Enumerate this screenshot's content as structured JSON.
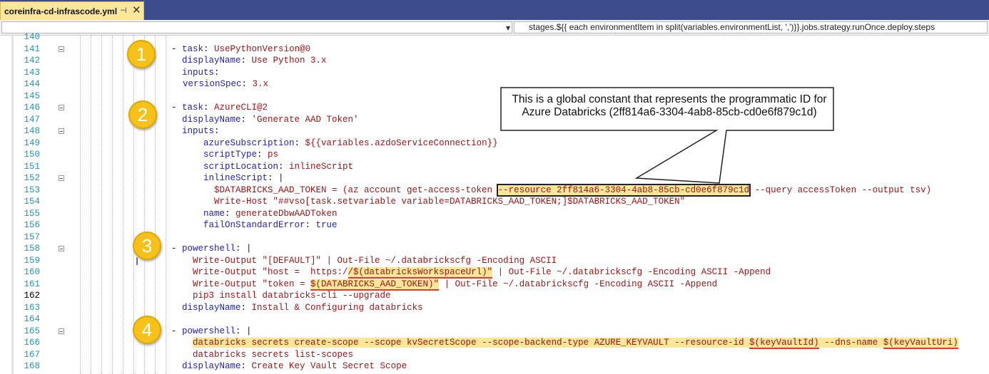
{
  "tab": {
    "title": "coreinfra-cd-infrascode.yml",
    "pin_icon": "pin-icon",
    "close_icon": "close-icon",
    "pin_glyph": "⊣",
    "close_glyph": "✕"
  },
  "navbar": {
    "left_value": "",
    "dropdown_icon": "chevron-down-icon",
    "dropdown_glyph": "▼",
    "right_value": "stages.${{ each environmentItem in split(variables.environmentList, ',')}}.jobs.strategy.runOnce.deploy.steps"
  },
  "editor": {
    "current_line": "162",
    "lines": [
      {
        "num": "140",
        "segs": []
      },
      {
        "num": "141",
        "segs": [
          [
            "- ",
            "t"
          ],
          [
            "task",
            "k"
          ],
          [
            ": ",
            "t"
          ],
          [
            "UsePythonVersion@0",
            "v"
          ]
        ]
      },
      {
        "num": "142",
        "segs": [
          [
            "displayName",
            "k"
          ],
          [
            ": ",
            "t"
          ],
          [
            "Use Python 3.x",
            "v"
          ]
        ]
      },
      {
        "num": "143",
        "segs": [
          [
            "inputs",
            "k"
          ],
          [
            ":",
            "t"
          ]
        ]
      },
      {
        "num": "144",
        "segs": [
          [
            "versionSpec",
            "k"
          ],
          [
            ": ",
            "t"
          ],
          [
            "3.x",
            "v"
          ]
        ]
      },
      {
        "num": "145",
        "segs": []
      },
      {
        "num": "146",
        "segs": [
          [
            "- ",
            "t"
          ],
          [
            "task",
            "k"
          ],
          [
            ": ",
            "t"
          ],
          [
            "AzureCLI@2",
            "v"
          ]
        ]
      },
      {
        "num": "147",
        "segs": [
          [
            "displayName",
            "k"
          ],
          [
            ": ",
            "t"
          ],
          [
            "'Generate AAD Token'",
            "v"
          ]
        ]
      },
      {
        "num": "148",
        "segs": [
          [
            "inputs",
            "k"
          ],
          [
            ":",
            "t"
          ]
        ]
      },
      {
        "num": "149",
        "segs": [
          [
            "azureSubscription",
            "k"
          ],
          [
            ": ",
            "t"
          ],
          [
            "${{variables.azdoServiceConnection}}",
            "v"
          ]
        ]
      },
      {
        "num": "150",
        "segs": [
          [
            "scriptType",
            "k"
          ],
          [
            ": ",
            "t"
          ],
          [
            "ps",
            "v"
          ]
        ]
      },
      {
        "num": "151",
        "segs": [
          [
            "scriptLocation",
            "k"
          ],
          [
            ": ",
            "t"
          ],
          [
            "inlineScript",
            "v"
          ]
        ]
      },
      {
        "num": "152",
        "segs": [
          [
            "inlineScript",
            "k"
          ],
          [
            ": |",
            "t"
          ]
        ]
      },
      {
        "num": "153",
        "segs": [
          [
            "$DATABRICKS_AAD_TOKEN = (az account get-access-token ",
            "v"
          ],
          [
            "--resource 2ff814a6-3304-4ab8-85cb-cd0e6f879c1d",
            "v hl boxhl"
          ],
          [
            " --query accessToken --output tsv)",
            "v"
          ]
        ]
      },
      {
        "num": "154",
        "segs": [
          [
            "Write-Host \"##vso[task.setvariable variable=DATABRICKS_AAD_TOKEN;]$DATABRICKS_AAD_TOKEN\"",
            "v"
          ]
        ]
      },
      {
        "num": "155",
        "segs": [
          [
            "name",
            "k"
          ],
          [
            ": ",
            "t"
          ],
          [
            "generateDbwAADToken",
            "v"
          ]
        ]
      },
      {
        "num": "156",
        "segs": [
          [
            "failOnStandardError",
            "k"
          ],
          [
            ": ",
            "t"
          ],
          [
            "true",
            "k"
          ]
        ]
      },
      {
        "num": "157",
        "segs": []
      },
      {
        "num": "158",
        "segs": [
          [
            "- ",
            "t"
          ],
          [
            "powershell",
            "k"
          ],
          [
            ": |",
            "t"
          ]
        ]
      },
      {
        "num": "159",
        "segs": [
          [
            "Write-Output \"[DEFAULT]\" | Out-File ~/.databrickscfg -Encoding ASCII",
            "v"
          ]
        ]
      },
      {
        "num": "160",
        "segs": [
          [
            "Write-Output \"host =  https:/",
            "v"
          ],
          [
            "/$(databricksWorkspaceUrl)\"",
            "v hl redline"
          ],
          [
            " | Out-File ~/.databrickscfg -Encoding ASCII -Append",
            "v"
          ]
        ]
      },
      {
        "num": "161",
        "segs": [
          [
            "Write-Output \"token = ",
            "v"
          ],
          [
            "$(DATABRICKS_AAD_TOKEN)\"",
            "v hl redline"
          ],
          [
            " | Out-File ~/.databrickscfg -Encoding ASCII -Append",
            "v"
          ]
        ]
      },
      {
        "num": "162",
        "segs": [
          [
            "pip3 install databricks-cli --upgrade",
            "v"
          ]
        ]
      },
      {
        "num": "163",
        "segs": [
          [
            "displayName",
            "k"
          ],
          [
            ": ",
            "t"
          ],
          [
            "Install & Configuring databricks",
            "v"
          ]
        ]
      },
      {
        "num": "164",
        "segs": []
      },
      {
        "num": "165",
        "segs": [
          [
            "- ",
            "t"
          ],
          [
            "powershell",
            "k"
          ],
          [
            ": |",
            "t"
          ]
        ]
      },
      {
        "num": "166",
        "segs": [
          [
            "databricks secrets create-scope --scope kvSecretScope --scope-backend-type AZURE_KEYVAULT --resource-id ",
            "v hl"
          ],
          [
            "$(keyVaultId)",
            "v hl redline"
          ],
          [
            " --dns-name ",
            "v hl"
          ],
          [
            "$(keyVaultUri)",
            "v hl redline"
          ]
        ]
      },
      {
        "num": "167",
        "segs": [
          [
            "databricks secrets list-scopes",
            "v"
          ]
        ]
      },
      {
        "num": "168",
        "segs": [
          [
            "displayName",
            "k"
          ],
          [
            ": ",
            "t"
          ],
          [
            "Create Key Vault Secret Scope",
            "v"
          ]
        ]
      }
    ]
  },
  "badges": [
    "1",
    "2",
    "3",
    "4"
  ],
  "callout": {
    "line1": "This is a global constant that represents the programmatic ID for",
    "line2": "Azure Databricks (2ff814a6-3304-4ab8-85cb-cd0e6f879c1d)"
  },
  "cursor_glyph": "I"
}
